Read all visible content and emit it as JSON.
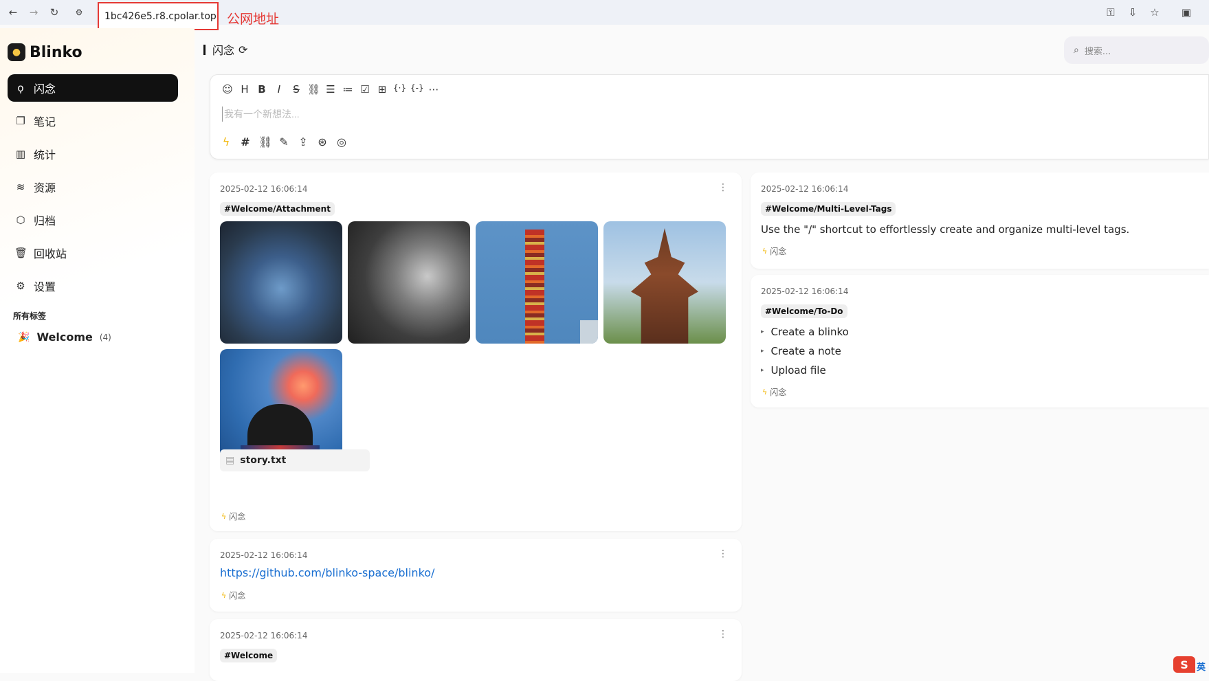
{
  "browser": {
    "url": "1bc426e5.r8.cpolar.top",
    "annotation": "公网地址",
    "icons": [
      "back-arrow-icon",
      "forward-arrow-icon",
      "reload-icon",
      "site-settings-icon",
      "key-icon",
      "install-icon",
      "star-icon",
      "profile-icon"
    ]
  },
  "sidebar": {
    "brand": "Blinko",
    "items": [
      {
        "label": "闪念",
        "icon": "lightbulb-icon"
      },
      {
        "label": "笔记",
        "icon": "notes-icon"
      },
      {
        "label": "统计",
        "icon": "chart-icon"
      },
      {
        "label": "资源",
        "icon": "database-icon"
      },
      {
        "label": "归档",
        "icon": "archive-icon"
      },
      {
        "label": "回收站",
        "icon": "trash-icon"
      },
      {
        "label": "设置",
        "icon": "gear-icon"
      }
    ],
    "tags_title": "所有标签",
    "tag": {
      "name": "Welcome",
      "count": "(4)"
    }
  },
  "header": {
    "title": "闪念",
    "search_placeholder": "搜索..."
  },
  "editor": {
    "placeholder": "我有一个新想法..."
  },
  "cards": {
    "attachment": {
      "date": "2025-02-12 16:06:14",
      "tag": "#Welcome/Attachment",
      "file": "story.txt",
      "footer": "闪念"
    },
    "link": {
      "date": "2025-02-12 16:06:14",
      "url": "https://github.com/blinko-space/blinko/",
      "footer": "闪念"
    },
    "welcome": {
      "date": "2025-02-12 16:06:14",
      "tag": "#Welcome"
    },
    "multilevel": {
      "date": "2025-02-12 16:06:14",
      "tag": "#Welcome/Multi-Level-Tags",
      "text": "Use the \"/\" shortcut to effortlessly create and organize multi-level tags.",
      "footer": "闪念"
    },
    "todo": {
      "date": "2025-02-12 16:06:14",
      "tag": "#Welcome/To-Do",
      "items": [
        "Create a blinko",
        "Create a note",
        "Upload file"
      ],
      "footer": "闪念"
    }
  },
  "ime": {
    "label": "英"
  }
}
